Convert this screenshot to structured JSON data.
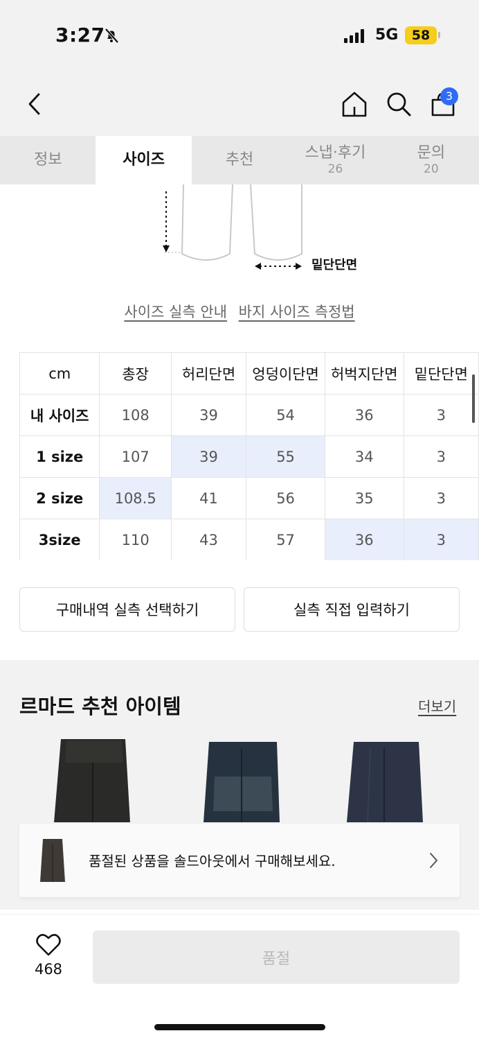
{
  "status": {
    "time": "3:27",
    "network": "5G",
    "battery": "58"
  },
  "nav": {
    "cart_count": "3"
  },
  "tabs": [
    {
      "label": "정보",
      "count": ""
    },
    {
      "label": "사이즈",
      "count": ""
    },
    {
      "label": "추천",
      "count": ""
    },
    {
      "label": "스냅·후기",
      "count": "26"
    },
    {
      "label": "문의",
      "count": "20"
    }
  ],
  "diagram": {
    "label": "밑단단면"
  },
  "links": {
    "guide": "사이즈 실측 안내",
    "measure": "바지 사이즈 측정법"
  },
  "size_table": {
    "headers": [
      "cm",
      "총장",
      "허리단면",
      "엉덩이단면",
      "허벅지단면",
      "밑단단면"
    ],
    "rows": [
      {
        "cells": [
          "내 사이즈",
          "108",
          "39",
          "54",
          "36",
          "3"
        ]
      },
      {
        "cells": [
          "1 size",
          "107",
          "39",
          "55",
          "34",
          "3"
        ]
      },
      {
        "cells": [
          "2 size",
          "108.5",
          "41",
          "56",
          "35",
          "3"
        ]
      },
      {
        "cells": [
          "3size",
          "110",
          "43",
          "57",
          "36",
          "3"
        ]
      }
    ],
    "highlight_color": "#e8eefc"
  },
  "buttons": {
    "purchase_history": "구매내역 실측 선택하기",
    "direct_input": "실측 직접 입력하기"
  },
  "reco": {
    "title": "르마드 추천 아이템",
    "more": "더보기"
  },
  "toast": {
    "text": "품절된 상품을 솔드아웃에서 구매해보세요."
  },
  "bottom": {
    "likes": "468",
    "cta": "품절"
  },
  "colors": {
    "accent_blue": "#2f6cf6",
    "battery_yellow": "#f5cd1a"
  }
}
